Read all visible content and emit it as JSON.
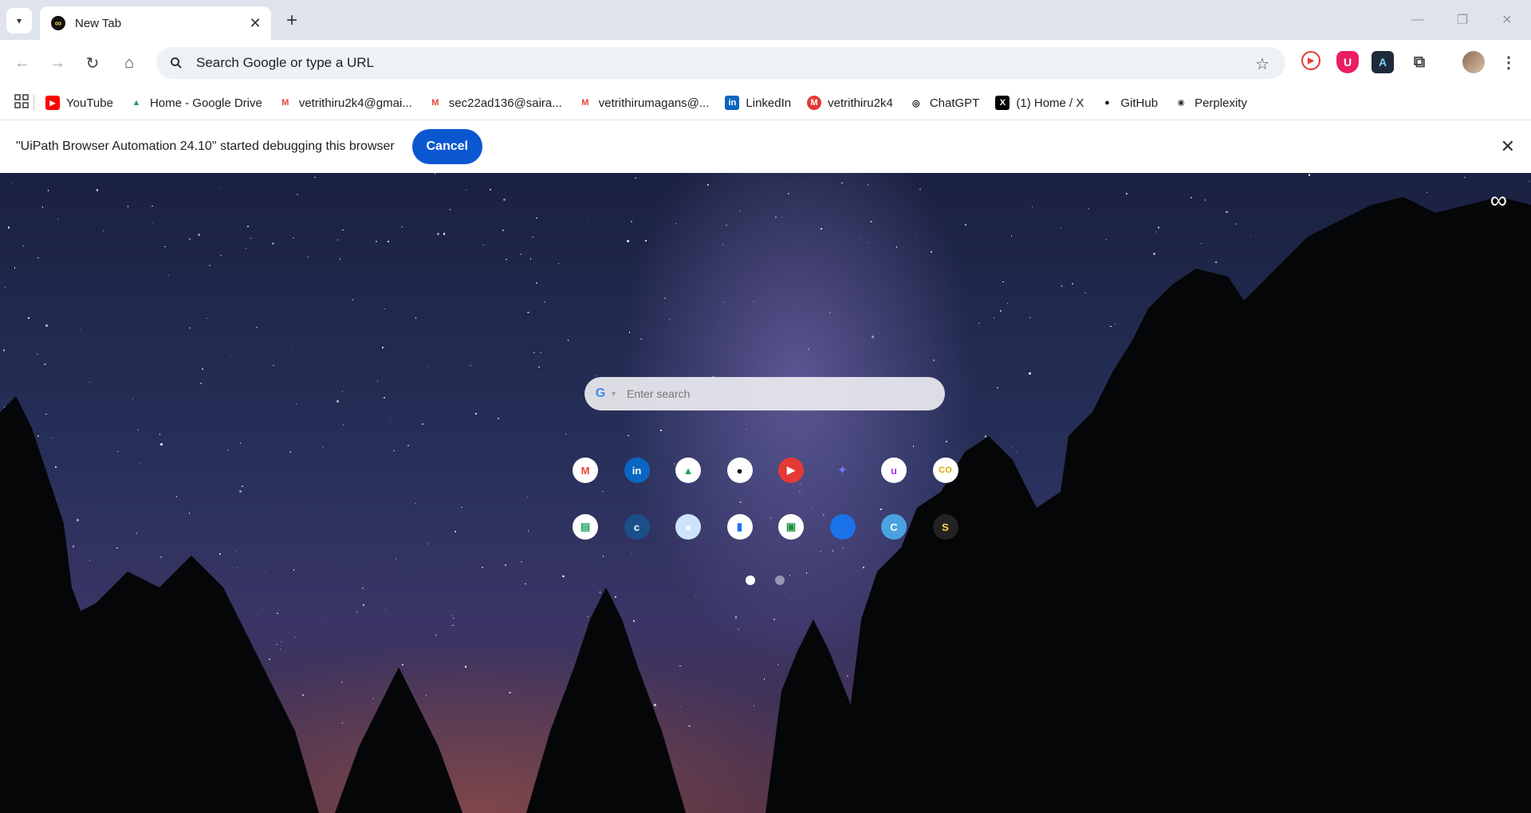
{
  "tab": {
    "title": "New Tab"
  },
  "omnibox": {
    "placeholder": "Search Google or type a URL"
  },
  "bookmarks": [
    {
      "label": "YouTube",
      "icon": "youtube-icon",
      "color": "#ff0000"
    },
    {
      "label": "Home - Google Drive",
      "icon": "google-drive-icon",
      "color": "#1fa463"
    },
    {
      "label": "vetrithiru2k4@gmai...",
      "icon": "gmail-icon",
      "color": "#ea4335"
    },
    {
      "label": "sec22ad136@saira...",
      "icon": "gmail-icon",
      "color": "#ea4335"
    },
    {
      "label": "vetrithirumagans@...",
      "icon": "gmail-icon",
      "color": "#ea4335"
    },
    {
      "label": "LinkedIn",
      "icon": "linkedin-icon",
      "color": "#0a66c2"
    },
    {
      "label": "vetrithiru2k4",
      "icon": "m-icon",
      "color": "#e53935"
    },
    {
      "label": "ChatGPT",
      "icon": "chatgpt-icon",
      "color": "#111111"
    },
    {
      "label": "(1) Home / X",
      "icon": "x-icon",
      "color": "#000000"
    },
    {
      "label": "GitHub",
      "icon": "github-icon",
      "color": "#111111"
    },
    {
      "label": "Perplexity",
      "icon": "perplexity-icon",
      "color": "#111111"
    }
  ],
  "infobar": {
    "message": "\"UiPath Browser Automation 24.10\" started debugging this browser",
    "cancel_label": "Cancel"
  },
  "newtab": {
    "search_placeholder": "Enter search",
    "logo_symbol": "∞",
    "shortcuts_row1": [
      {
        "icon": "gmail-icon",
        "glyph": "M",
        "bg": "#ffffff",
        "fg": "#ea4335"
      },
      {
        "icon": "linkedin-icon",
        "glyph": "in",
        "bg": "#0a66c2",
        "fg": "#ffffff"
      },
      {
        "icon": "google-drive-icon",
        "glyph": "▲",
        "bg": "#ffffff",
        "fg": "#1fa463"
      },
      {
        "icon": "github-icon",
        "glyph": "●",
        "bg": "#ffffff",
        "fg": "#111111"
      },
      {
        "icon": "youtube-icon",
        "glyph": "▶",
        "bg": "#e53935",
        "fg": "#ffffff"
      },
      {
        "icon": "gemini-icon",
        "glyph": "✦",
        "bg": "transparent",
        "fg": "#6b7cff"
      },
      {
        "icon": "udemy-icon",
        "glyph": "u",
        "bg": "#ffffff",
        "fg": "#a435f0"
      },
      {
        "icon": "coursera-co-icon",
        "glyph": "CO",
        "bg": "#ffffff",
        "fg": "#e0a800"
      }
    ],
    "shortcuts_row2": [
      {
        "icon": "sheets-icon",
        "glyph": "▤",
        "bg": "#ffffff",
        "fg": "#1fa463"
      },
      {
        "icon": "coursera-icon",
        "glyph": "c",
        "bg": "#1b4f8a",
        "fg": "#ffffff"
      },
      {
        "icon": "chat-icon",
        "glyph": "●",
        "bg": "#cfe3ff",
        "fg": "#ffffff"
      },
      {
        "icon": "docs-icon",
        "glyph": "▮",
        "bg": "#ffffff",
        "fg": "#1a73e8"
      },
      {
        "icon": "classroom-icon",
        "glyph": "▣",
        "bg": "#ffffff",
        "fg": "#1e8e3e"
      },
      {
        "icon": "blue-circle-icon",
        "glyph": "",
        "bg": "#1a73e8",
        "fg": "#ffffff"
      },
      {
        "icon": "canva-icon",
        "glyph": "C",
        "bg": "#4aa3df",
        "fg": "#ffffff"
      },
      {
        "icon": "skillrack-icon",
        "glyph": "S",
        "bg": "#222222",
        "fg": "#ffd54a"
      }
    ],
    "pages": {
      "current": 1,
      "total": 2
    }
  }
}
